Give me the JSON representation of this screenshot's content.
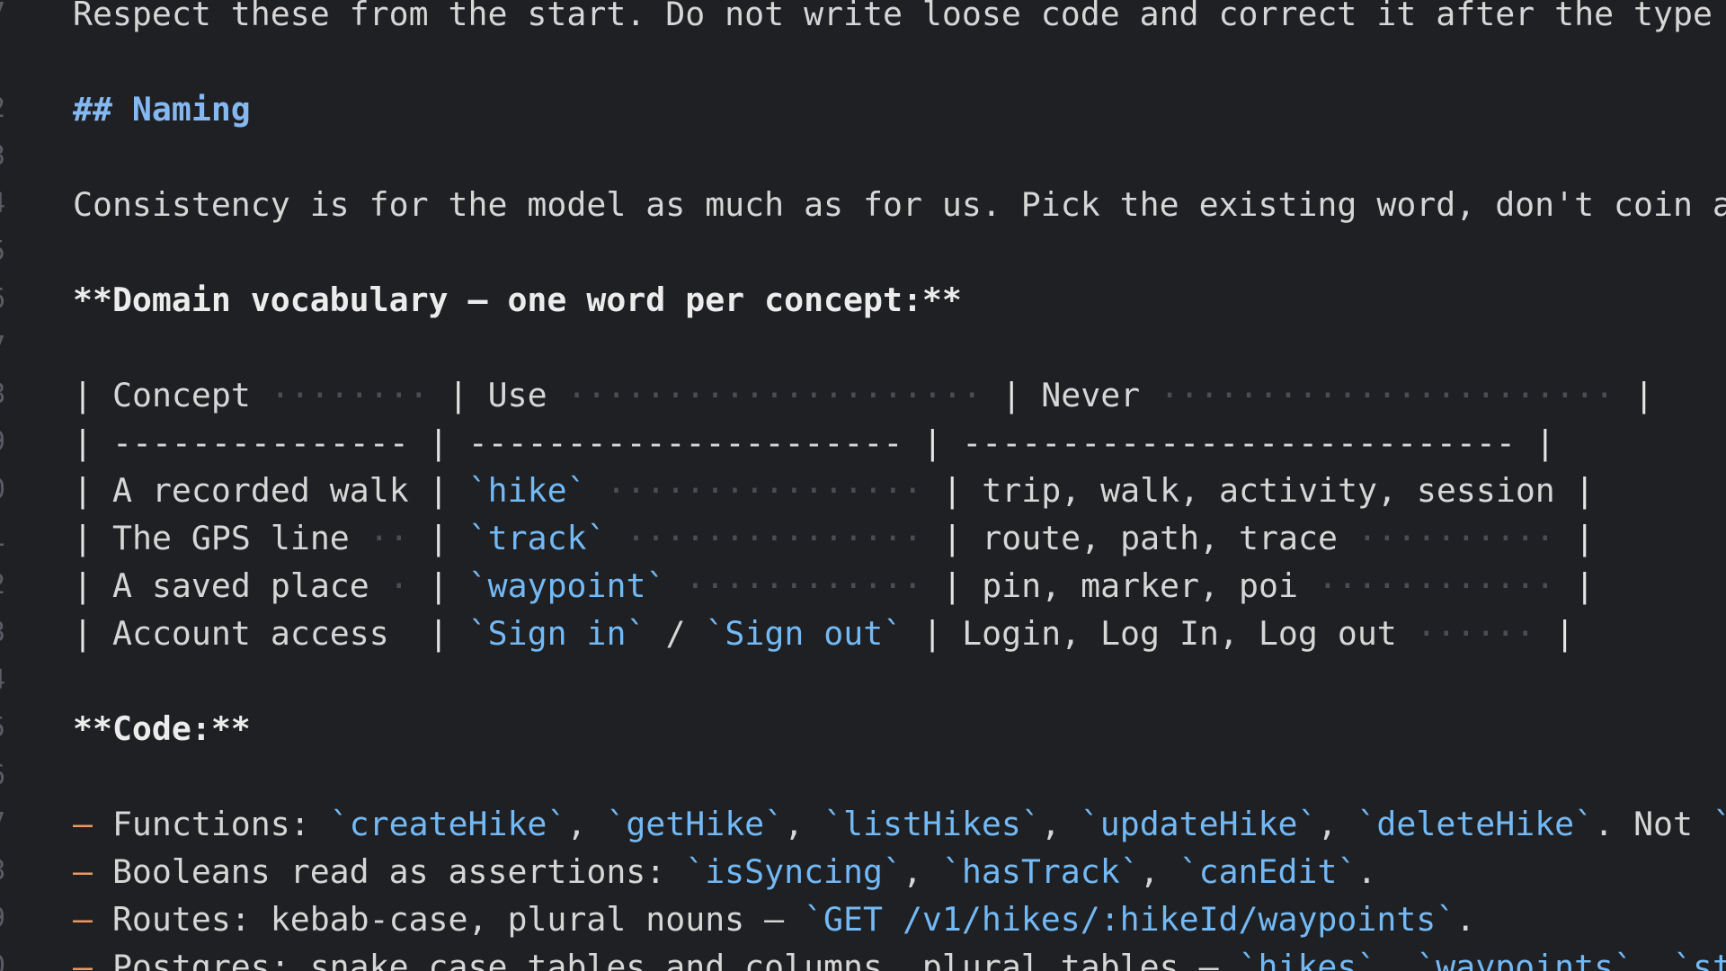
{
  "gutter": [
    "7",
    "",
    "2",
    "3",
    "4",
    "5",
    "6",
    "7",
    "8",
    "9",
    "0",
    "1",
    "2",
    "3",
    "4",
    "5",
    "6",
    "7",
    "8",
    "9",
    "0"
  ],
  "lines": [
    {
      "segments": [
        {
          "text": "Respect these from the start. Do not write loose code and correct it after the type che",
          "style": "plain"
        }
      ]
    },
    {
      "segments": []
    },
    {
      "segments": [
        {
          "text": "## Naming",
          "style": "hd"
        }
      ]
    },
    {
      "segments": []
    },
    {
      "segments": [
        {
          "text": "Consistency is for the model as much as for us. Pick the existing word, don't coin a ne",
          "style": "plain"
        }
      ]
    },
    {
      "segments": []
    },
    {
      "segments": [
        {
          "text": "**Domain vocabulary – one word per concept:**",
          "style": "bold"
        }
      ]
    },
    {
      "segments": []
    },
    {
      "segments": [
        {
          "text": "| Concept ········ | Use ····················· | Never ······················· |",
          "style": "table"
        }
      ]
    },
    {
      "segments": [
        {
          "text": "| --------------- | ---------------------- | ---------------------------- |",
          "style": "table"
        }
      ]
    },
    {
      "segments": [
        {
          "text": "| A recorded walk | ",
          "style": "table"
        },
        {
          "text": "`hike`",
          "style": "code"
        },
        {
          "text": " ················ | trip, walk, activity, session |",
          "style": "table"
        }
      ]
    },
    {
      "segments": [
        {
          "text": "| The GPS line ·· | ",
          "style": "table"
        },
        {
          "text": "`track`",
          "style": "code"
        },
        {
          "text": " ··············· | route, path, trace ·········· |",
          "style": "table"
        }
      ]
    },
    {
      "segments": [
        {
          "text": "| A saved place · | ",
          "style": "table"
        },
        {
          "text": "`waypoint`",
          "style": "code"
        },
        {
          "text": " ············ | pin, marker, poi ············ |",
          "style": "table"
        }
      ]
    },
    {
      "segments": [
        {
          "text": "| Account access  | ",
          "style": "table"
        },
        {
          "text": "`Sign in`",
          "style": "code"
        },
        {
          "text": " / ",
          "style": "table"
        },
        {
          "text": "`Sign out`",
          "style": "code"
        },
        {
          "text": " | Login, Log In, Log out ······ |",
          "style": "table"
        }
      ]
    },
    {
      "segments": []
    },
    {
      "segments": [
        {
          "text": "**Code:**",
          "style": "bold"
        }
      ]
    },
    {
      "segments": []
    },
    {
      "segments": [
        {
          "text": "– ",
          "style": "bullet"
        },
        {
          "text": "Functions: ",
          "style": "plain"
        },
        {
          "text": "`createHike`",
          "style": "code"
        },
        {
          "text": ", ",
          "style": "plain"
        },
        {
          "text": "`getHike`",
          "style": "code"
        },
        {
          "text": ", ",
          "style": "plain"
        },
        {
          "text": "`listHikes`",
          "style": "code"
        },
        {
          "text": ", ",
          "style": "plain"
        },
        {
          "text": "`updateHike`",
          "style": "code"
        },
        {
          "text": ", ",
          "style": "plain"
        },
        {
          "text": "`deleteHike`",
          "style": "code"
        },
        {
          "text": ". Not ",
          "style": "plain"
        },
        {
          "text": "`fet",
          "style": "code"
        }
      ]
    },
    {
      "segments": [
        {
          "text": "– ",
          "style": "bullet"
        },
        {
          "text": "Booleans read as assertions: ",
          "style": "plain"
        },
        {
          "text": "`isSyncing`",
          "style": "code"
        },
        {
          "text": ", ",
          "style": "plain"
        },
        {
          "text": "`hasTrack`",
          "style": "code"
        },
        {
          "text": ", ",
          "style": "plain"
        },
        {
          "text": "`canEdit`",
          "style": "code"
        },
        {
          "text": ".",
          "style": "plain"
        }
      ]
    },
    {
      "segments": [
        {
          "text": "– ",
          "style": "bullet"
        },
        {
          "text": "Routes: kebab-case, plural nouns – ",
          "style": "plain"
        },
        {
          "text": "`GET /v1/hikes/:hikeId/waypoints`",
          "style": "code"
        },
        {
          "text": ".",
          "style": "plain"
        }
      ]
    },
    {
      "segments": [
        {
          "text": "– ",
          "style": "bullet"
        },
        {
          "text": "Postgres: snake_case tables and columns, plural tables – ",
          "style": "plain"
        },
        {
          "text": "`hikes`",
          "style": "code"
        },
        {
          "text": ", ",
          "style": "plain"
        },
        {
          "text": "`waypoints`",
          "style": "code"
        },
        {
          "text": ", ",
          "style": "plain"
        },
        {
          "text": "`start",
          "style": "code"
        }
      ]
    }
  ]
}
